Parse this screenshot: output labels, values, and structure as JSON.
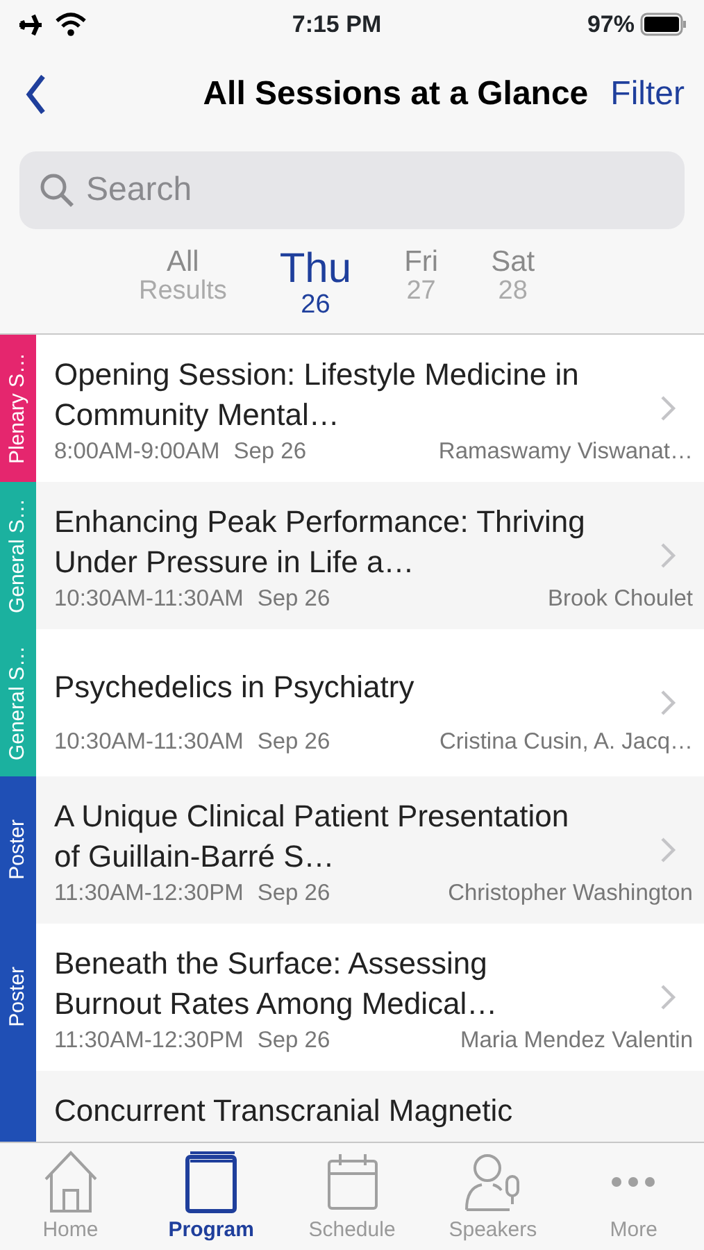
{
  "status_bar": {
    "time": "7:15 PM",
    "battery": "97%"
  },
  "nav": {
    "title": "All Sessions at a Glance",
    "action": "Filter"
  },
  "search": {
    "placeholder": "Search"
  },
  "day_tabs": [
    {
      "label": "All",
      "sub": "Results",
      "selected": false
    },
    {
      "label": "Thu",
      "sub": "26",
      "selected": true
    },
    {
      "label": "Fri",
      "sub": "27",
      "selected": false
    },
    {
      "label": "Sat",
      "sub": "28",
      "selected": false
    }
  ],
  "sessions": [
    {
      "track": "Plenary S…",
      "color": "#e5266e",
      "title": "Opening Session: Lifestyle Medicine in Community Mental…",
      "time": "8:00AM-9:00AM",
      "date": "Sep 26",
      "speakers": "Ramaswamy Viswanat…"
    },
    {
      "track": "General S…",
      "color": "#1bb19f",
      "title": "Enhancing Peak Performance: Thriving Under Pressure in Life a…",
      "time": "10:30AM-11:30AM",
      "date": "Sep 26",
      "speakers": "Brook Choulet"
    },
    {
      "track": "General S…",
      "color": "#1bb19f",
      "title": "Psychedelics in Psychiatry",
      "time": "10:30AM-11:30AM",
      "date": "Sep 26",
      "speakers": "Cristina Cusin, A. Jacq…"
    },
    {
      "track": "Poster",
      "color": "#1f4fb5",
      "title": "A Unique Clinical Patient Presentation of Guillain-Barré S…",
      "time": "11:30AM-12:30PM",
      "date": "Sep 26",
      "speakers": "Christopher Washington"
    },
    {
      "track": "Poster",
      "color": "#1f4fb5",
      "title": "Beneath the Surface: Assessing Burnout Rates Among Medical…",
      "time": "11:30AM-12:30PM",
      "date": "Sep 26",
      "speakers": "Maria Mendez Valentin"
    },
    {
      "color": "#1f4fb5",
      "title": "Concurrent Transcranial Magnetic"
    }
  ],
  "tab_bar": [
    {
      "kind": "home",
      "label": "Home",
      "selected": false
    },
    {
      "kind": "program",
      "label": "Program",
      "selected": true
    },
    {
      "kind": "schedule",
      "label": "Schedule",
      "selected": false
    },
    {
      "kind": "speakers",
      "label": "Speakers",
      "selected": false
    },
    {
      "kind": "more",
      "label": "More",
      "selected": false
    }
  ]
}
